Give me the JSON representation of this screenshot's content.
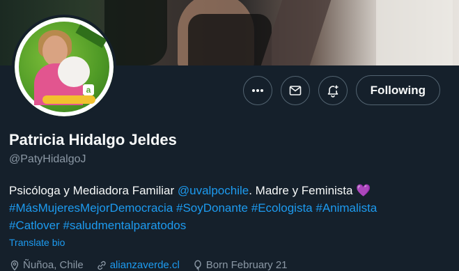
{
  "colors": {
    "background": "#15202b",
    "text_primary": "#f7f9f9",
    "text_secondary": "#8b98a5",
    "link": "#1d9bf0",
    "button_border": "#536471"
  },
  "profile": {
    "display_name": "Patricia Hidalgo Jeldes",
    "handle": "@PatyHidalgoJ"
  },
  "actions": {
    "more_icon": "more-icon",
    "message_icon": "envelope-icon",
    "notify_icon": "bell-plus-icon",
    "following_label": "Following"
  },
  "bio": {
    "text_1": "Psicóloga y Mediadora Familiar ",
    "mention": "@uvalpochile",
    "text_2": ". Madre y Feminista ",
    "emoji": "💜",
    "hashtags_line1": [
      "#MásMujeresMejorDemocracia",
      "#SoyDonante",
      "#Ecologista",
      "#Animalista"
    ],
    "hashtags_line2": [
      "#Catlover",
      "#saludmentalparatodos"
    ]
  },
  "translate_label": "Translate bio",
  "meta": {
    "location": "Ñuñoa, Chile",
    "website": "alianzaverde.cl",
    "born": "Born February 21"
  }
}
